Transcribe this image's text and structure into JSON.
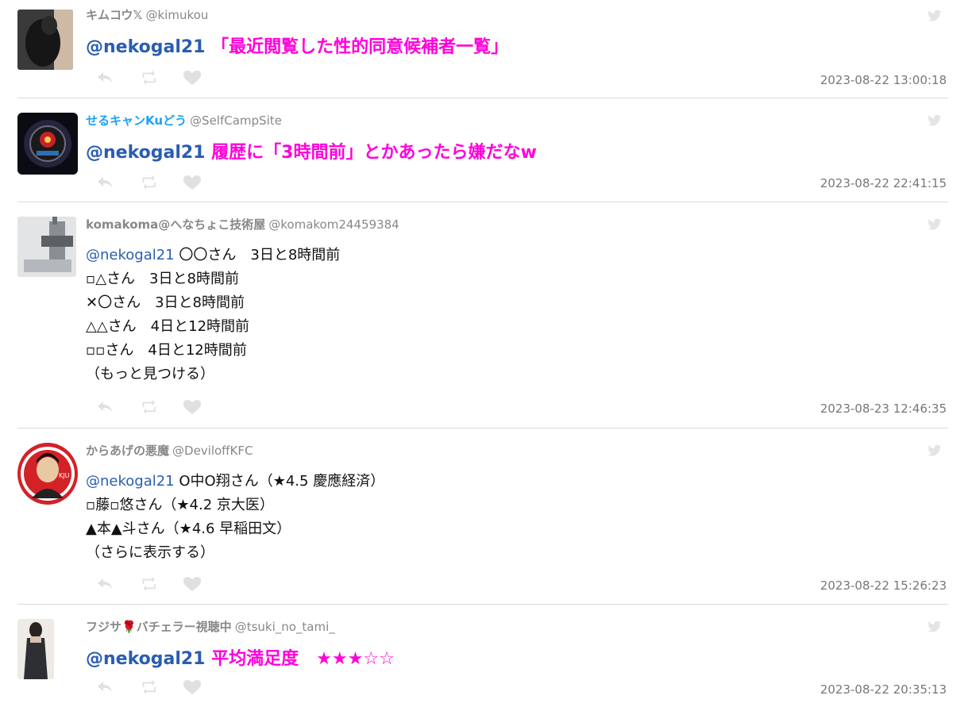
{
  "colors": {
    "accent_pink": "#ff00d9",
    "mention_blue": "#2a5db0",
    "name_blue": "#1da1f2",
    "muted": "#888888"
  },
  "tweets": [
    {
      "name": "キムコウ𝕏",
      "handle": "@kimukou",
      "mention": "@nekogal21",
      "text": "「最近閲覧した性的同意候補者一覧」",
      "date": "2023-08-22 13:00:18"
    },
    {
      "name": "せるキャンKuどう",
      "handle": "@SelfCampSite",
      "mention": "@nekogal21",
      "text": "履歴に「3時間前」とかあったら嫌だなw",
      "date": "2023-08-22 22:41:15"
    },
    {
      "name": "komakoma@へなちょこ技術屋",
      "handle": "@komakom24459384",
      "mention": "@nekogal21",
      "first_line": "〇〇さん　3日と8時間前",
      "lines": [
        "▫△さん　3日と8時間前",
        "✕〇さん　3日と8時間前",
        "△△さん　4日と12時間前",
        "▫▫さん　4日と12時間前",
        "（もっと見つける）"
      ],
      "date": "2023-08-23 12:46:35"
    },
    {
      "name": "からあげの悪魔",
      "handle": "@DeviloffKFC",
      "mention": "@nekogal21",
      "first_line": "O中O翔さん（★4.5 慶應経済）",
      "lines": [
        "▫藤▫悠さん（★4.2 京大医）",
        "▲本▲斗さん（★4.6 早稲田文）",
        "（さらに表示する）"
      ],
      "date": "2023-08-22 15:26:23"
    },
    {
      "name": "フジサ🌹バチェラー視聴中",
      "handle": "@tsuki_no_tami_",
      "mention": "@nekogal21",
      "text": "平均満足度　★★★☆☆",
      "date": "2023-08-22 20:35:13"
    }
  ]
}
